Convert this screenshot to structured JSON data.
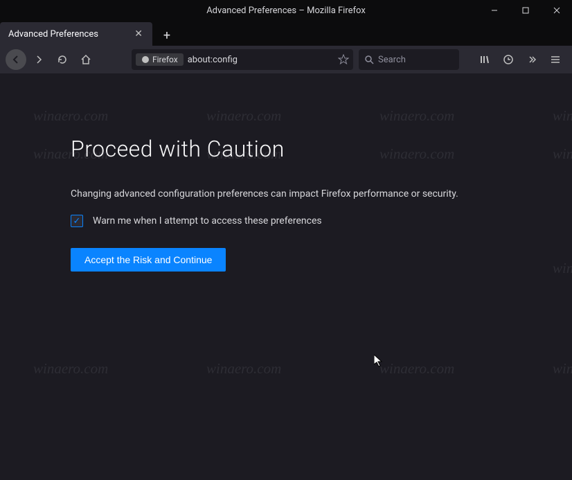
{
  "window": {
    "title": "Advanced Preferences – Mozilla Firefox"
  },
  "tab": {
    "title": "Advanced Preferences"
  },
  "urlbar": {
    "identity": "Firefox",
    "url": "about:config"
  },
  "searchbar": {
    "placeholder": "Search"
  },
  "page": {
    "heading": "Proceed with Caution",
    "warning": "Changing advanced configuration preferences can impact Firefox performance or security.",
    "checkbox_label": "Warn me when I attempt to access these preferences",
    "accept_label": "Accept the Risk and Continue"
  },
  "watermark": "winaero.com"
}
